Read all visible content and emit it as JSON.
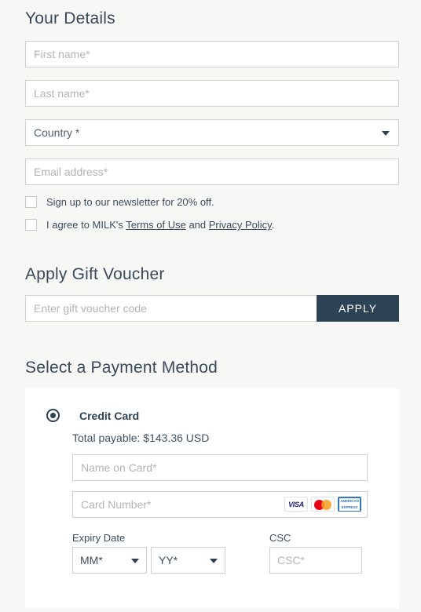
{
  "your_details": {
    "heading": "Your Details",
    "first_name_placeholder": "First name*",
    "last_name_placeholder": "Last name*",
    "country_value": "Country *",
    "email_placeholder": "Email address*",
    "newsletter_label": "Sign up to our newsletter for 20% off.",
    "agree_prefix": "I agree to MILK's ",
    "terms_link": "Terms of Use",
    "agree_middle": " and ",
    "privacy_link": "Privacy Policy",
    "agree_suffix": "."
  },
  "gift_voucher": {
    "heading": "Apply Gift Voucher",
    "input_placeholder": "Enter gift voucher code",
    "apply_label": "APPLY"
  },
  "payment": {
    "heading": "Select a Payment Method",
    "method_label": "Credit Card",
    "total_text": "Total payable: $143.36 USD",
    "name_on_card_placeholder": "Name on Card*",
    "card_number_placeholder": "Card Number*",
    "brands": {
      "visa": "VISA",
      "amex_top": "AMERICAN",
      "amex_bottom": "EXPRESS"
    },
    "expiry_label": "Expiry Date",
    "month_value": "MM*",
    "year_value": "YY*",
    "csc_label": "CSC",
    "csc_placeholder": "CSC*"
  },
  "colors": {
    "page_background": "#f7f7f5",
    "heading": "#3a4a5a",
    "accent_dark": "#2c4355",
    "field_border": "#d2d2d2",
    "placeholder": "#b4b4b4",
    "panel": "#ffffff"
  }
}
